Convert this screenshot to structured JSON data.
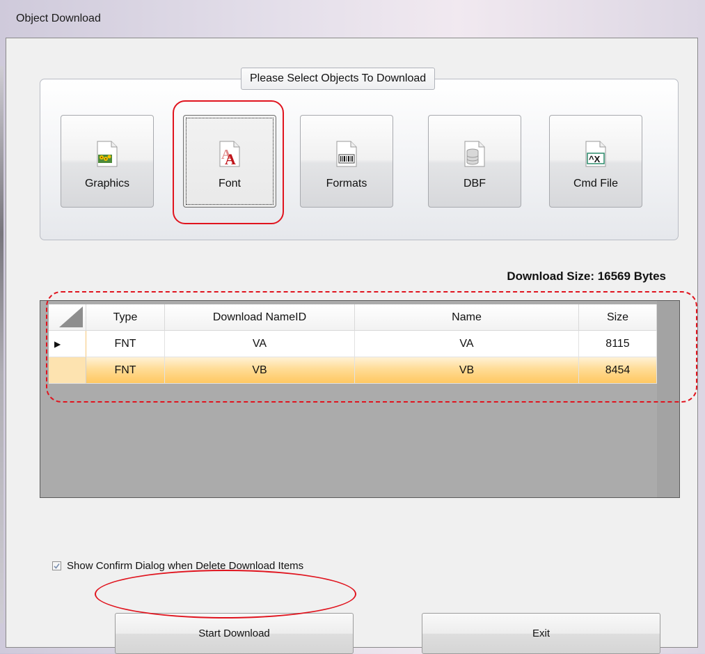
{
  "window": {
    "title": "Object Download"
  },
  "group": {
    "title": "Please Select Objects To Download"
  },
  "objects": [
    {
      "label": "Graphics",
      "icon": "graphics-file-icon",
      "selected": false
    },
    {
      "label": "Font",
      "icon": "font-file-icon",
      "selected": true
    },
    {
      "label": "Formats",
      "icon": "barcode-file-icon",
      "selected": false
    },
    {
      "label": "DBF",
      "icon": "database-file-icon",
      "selected": false
    },
    {
      "label": "Cmd File",
      "icon": "command-file-icon",
      "selected": false
    }
  ],
  "download_size": "Download Size: 16569 Bytes",
  "grid": {
    "columns": [
      "Type",
      "Download NameID",
      "Name",
      "Size"
    ],
    "rows": [
      [
        "FNT",
        "VA",
        "VA",
        "8115"
      ],
      [
        "FNT",
        "VB",
        "VB",
        "8454"
      ]
    ],
    "current_row_marker": "▶"
  },
  "confirm_checkbox": {
    "label": "Show Confirm Dialog when Delete Download Items",
    "checked": true
  },
  "buttons": {
    "start": "Start Download",
    "exit": "Exit"
  },
  "colors": {
    "annotation": "#e0141e",
    "selected_row": "#ffd47a",
    "grid_background": "#ababab"
  }
}
